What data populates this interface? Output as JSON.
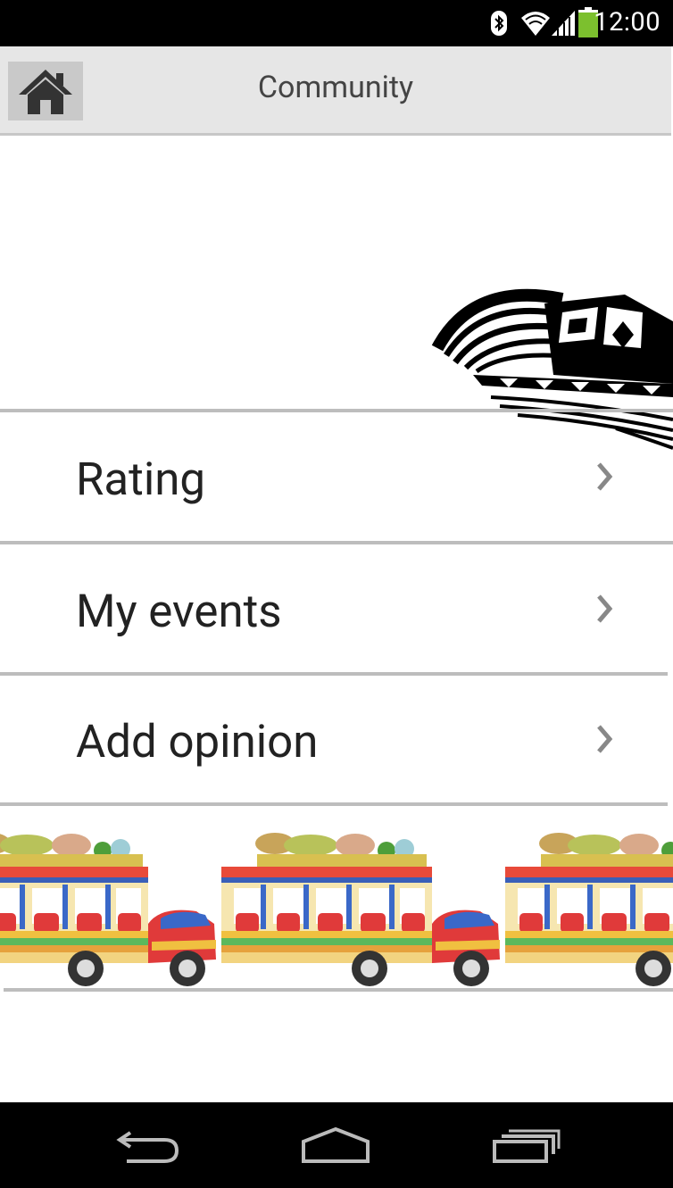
{
  "status_bar": {
    "time": "12:00",
    "icons": [
      "bluetooth-icon",
      "wifi-icon",
      "signal-icon",
      "battery-icon"
    ]
  },
  "action_bar": {
    "title": "Community",
    "home_icon": "home-icon"
  },
  "menu": {
    "items": [
      {
        "label": "Rating",
        "icon": "chevron-right-icon"
      },
      {
        "label": "My events",
        "icon": "chevron-right-icon"
      },
      {
        "label": "Add opinion",
        "icon": "chevron-right-icon"
      }
    ]
  },
  "decorations": [
    "sombrero-vueltiao-image",
    "chiva-bus-image"
  ],
  "nav_bar": {
    "buttons": [
      "back-icon",
      "home-nav-icon",
      "recent-apps-icon"
    ]
  },
  "colors": {
    "action_bar_bg": "#e6e6e6",
    "home_button_bg": "#c9c9c9",
    "divider": "#bdbdbd",
    "battery": "#7cc02e"
  }
}
